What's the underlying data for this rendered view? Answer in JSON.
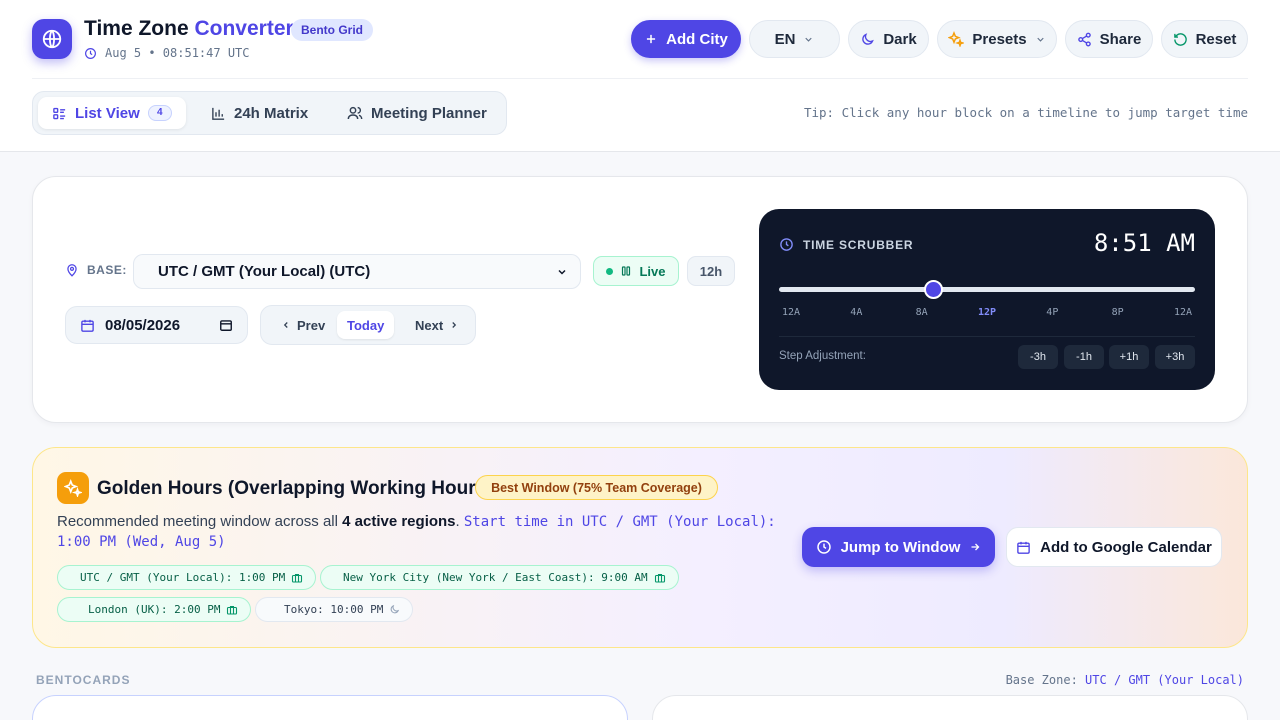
{
  "header": {
    "title_main": "Time Zone",
    "title_accent": "Converter",
    "badge": "Bento Grid",
    "clock_text": "Aug 5 • 08:51:47 UTC",
    "logo_icon": "globe-icon"
  },
  "toolbar": {
    "add_city": "Add City",
    "language": "EN",
    "theme": "Dark",
    "presets": "Presets",
    "share": "Share",
    "reset": "Reset"
  },
  "tabs": [
    {
      "label": "List View",
      "count": "4",
      "icon": "list-icon",
      "active": true
    },
    {
      "label": "24h Matrix",
      "icon": "bar-chart-icon",
      "active": false
    },
    {
      "label": "Meeting Planner",
      "icon": "users-icon",
      "active": false
    }
  ],
  "tip": "Tip: Click any hour block on a timeline to jump target time",
  "controls": {
    "base_label": "BASE:",
    "base_value": "UTC / GMT (Your Local) (UTC)",
    "live_label": "Live",
    "format_label": "12h",
    "date_value": "08/05/2026",
    "prev_label": "Prev",
    "today_label": "Today",
    "next_label": "Next"
  },
  "scrubber": {
    "label": "TIME SCRUBBER",
    "time": "8:51 AM",
    "progress_fraction": 0.37,
    "tick_labels": [
      "12A",
      "4A",
      "8A",
      "12P",
      "4P",
      "8P",
      "12A"
    ],
    "highlight_tick": "12P",
    "step_label": "Step Adjustment:",
    "steps": [
      "-3h",
      "-1h",
      "+1h",
      "+3h"
    ]
  },
  "golden": {
    "title": "Golden Hours (Overlapping Working Hours)",
    "badge": "Best Window (75% Team Coverage)",
    "desc_prefix": "Recommended meeting window across all",
    "desc_bold": "4 active regions",
    "desc_mono": "Start time in UTC / GMT (Your Local): 1:00 PM (Wed, Aug 5)",
    "chips": [
      {
        "text": "UTC / GMT (Your Local): 1:00 PM",
        "icon": "briefcase-icon",
        "working": true
      },
      {
        "text": "New York City (New York / East Coast): 9:00 AM",
        "icon": "briefcase-icon",
        "working": true
      },
      {
        "text": "London (UK): 2:00 PM",
        "icon": "briefcase-icon",
        "working": true
      },
      {
        "text": "Tokyo: 10:00 PM",
        "icon": "moon-icon",
        "working": false
      }
    ],
    "jump_label": "Jump to Window",
    "gcal_label": "Add to Google Calendar"
  },
  "bento": {
    "section_label": "BENTOCARDS",
    "base_zone_label": "Base Zone:",
    "base_zone_value": "UTC / GMT (Your Local)"
  },
  "colors": {
    "accent": "#4f46e5",
    "scrubber_bg": "#0f172a",
    "live_green": "#047857",
    "golden_icon": "#f59e0b"
  }
}
